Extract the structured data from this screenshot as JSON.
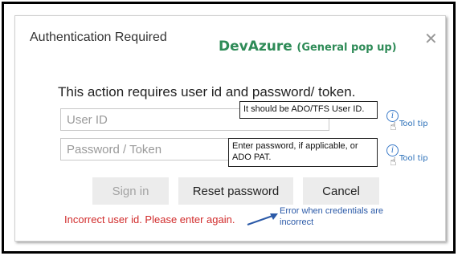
{
  "dialog": {
    "title": "Authentication Required",
    "brand_name": "DevAzure",
    "brand_note": "(General pop up)",
    "close_glyph": "✕",
    "instruction": "This action requires user id and password/ token.",
    "user_id_placeholder": "User ID",
    "password_placeholder": "Password / Token",
    "tooltip_user": "It should be ADO/TFS User ID.",
    "tooltip_password_line1": "Enter password, if applicable, or",
    "tooltip_password_line2": "ADO PAT.",
    "tooltip_label": "Tool tip",
    "buttons": {
      "sign_in": "Sign in",
      "reset": "Reset password",
      "cancel": "Cancel"
    },
    "error_message": "Incorrect user id. Please enter again.",
    "error_annotation_line1": "Error when credentials are",
    "error_annotation_line2": "incorrect"
  },
  "colors": {
    "brand": "#2e8b57",
    "error": "#d12b2b",
    "annotation": "#2b5aa8",
    "button_bg": "#ececec"
  },
  "icons": [
    "close-icon",
    "info-icon",
    "hand-pointer-icon",
    "arrow-icon"
  ]
}
